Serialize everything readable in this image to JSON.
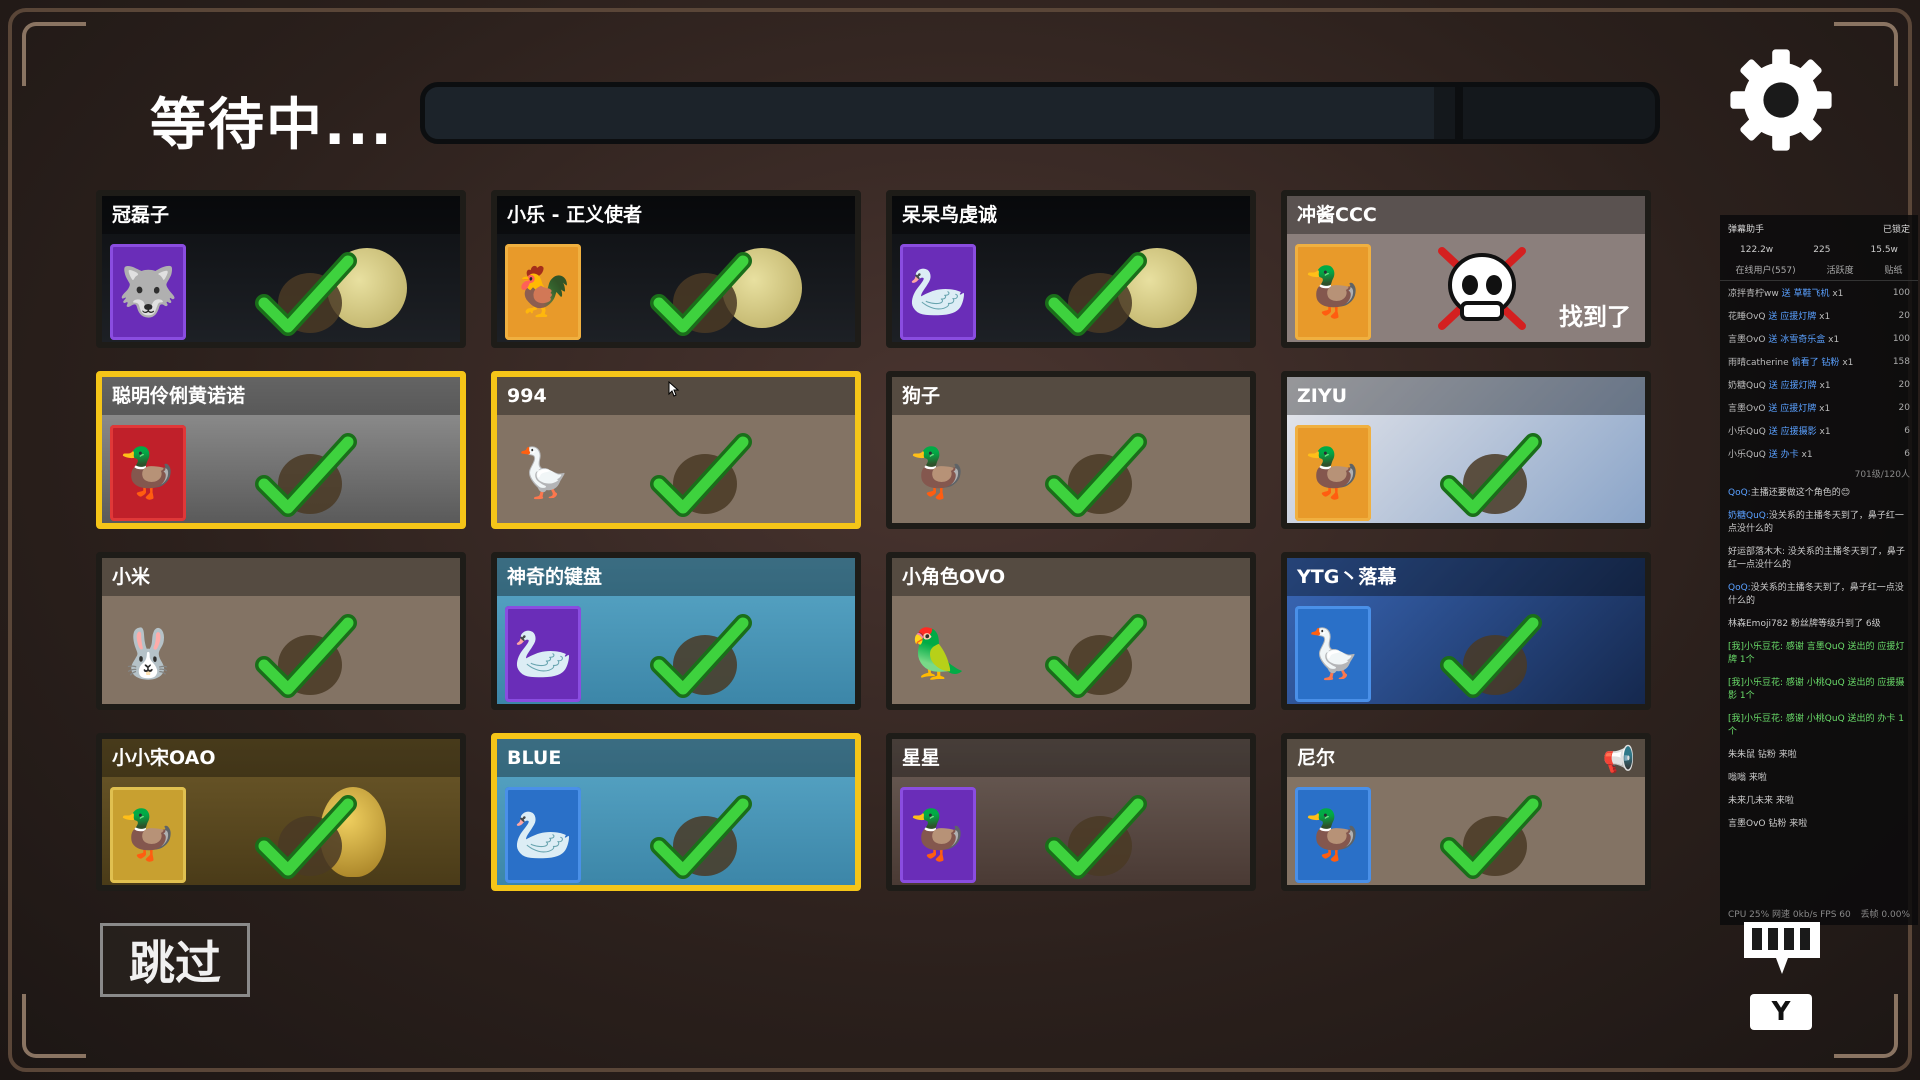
{
  "header": {
    "title": "等待中...",
    "progress": 0.82
  },
  "players": [
    {
      "name": "冠磊子",
      "bg": "bg-night",
      "portrait": "p-purple",
      "emoji": "🐺",
      "prop": "moon",
      "highlight": false
    },
    {
      "name": "小乐 - 正义使者",
      "bg": "bg-night",
      "portrait": "p-orange",
      "emoji": "🐓",
      "prop": "moon",
      "highlight": false
    },
    {
      "name": "呆呆鸟虔诚",
      "bg": "bg-night",
      "portrait": "p-purple",
      "emoji": "🦢",
      "prop": "moon",
      "highlight": false
    },
    {
      "name": "冲酱CCC",
      "bg": "bg-found",
      "portrait": "p-orange",
      "emoji": "🦆",
      "prop": "skull",
      "highlight": false,
      "status": "找到了"
    },
    {
      "name": "聪明伶俐黄诺诺",
      "bg": "bg-castle",
      "portrait": "p-red",
      "emoji": "🦆",
      "prop": "none",
      "highlight": true
    },
    {
      "name": "994",
      "bg": "bg-plain",
      "portrait": "p-none",
      "emoji": "🪿",
      "prop": "none",
      "highlight": true
    },
    {
      "name": "狗子",
      "bg": "bg-plain",
      "portrait": "p-none",
      "emoji": "🦆",
      "prop": "none",
      "highlight": false
    },
    {
      "name": "ZIYU",
      "bg": "bg-ziyu",
      "portrait": "p-orange",
      "emoji": "🦆",
      "prop": "none",
      "highlight": false
    },
    {
      "name": "小米",
      "bg": "bg-plain",
      "portrait": "p-none",
      "emoji": "🐰",
      "prop": "none",
      "highlight": false
    },
    {
      "name": "神奇的键盘",
      "bg": "bg-sky",
      "portrait": "p-purple",
      "emoji": "🦢",
      "prop": "none",
      "highlight": false
    },
    {
      "name": "小角色OVO",
      "bg": "bg-plain",
      "portrait": "p-none",
      "emoji": "🦜",
      "prop": "none",
      "highlight": false
    },
    {
      "name": "YTG丶落幕",
      "bg": "bg-ytg",
      "portrait": "p-blue",
      "emoji": "🪿",
      "prop": "none",
      "highlight": false
    },
    {
      "name": "小小宋OAO",
      "bg": "bg-gold",
      "portrait": "p-gold",
      "emoji": "🦆",
      "prop": "egg",
      "highlight": false
    },
    {
      "name": "BLUE",
      "bg": "bg-sky",
      "portrait": "p-blue",
      "emoji": "🦢",
      "prop": "none",
      "highlight": true
    },
    {
      "name": "星星",
      "bg": "bg-leaves",
      "portrait": "p-purple",
      "emoji": "🦆",
      "prop": "none",
      "highlight": false
    },
    {
      "name": "尼尔",
      "bg": "bg-plain",
      "portrait": "p-blue",
      "emoji": "🦆",
      "prop": "speaker",
      "highlight": false
    }
  ],
  "controls": {
    "skip_label": "跳过",
    "hotkey": "Y"
  },
  "sidebar": {
    "title": "弹幕助手",
    "lock_label": "已锁定",
    "stats": {
      "likes": "122.2w",
      "viewers": "225",
      "follows": "15.5w"
    },
    "tabs": [
      "在线用户(557)",
      "活跃度",
      "贴纸"
    ],
    "gifts": [
      {
        "user": "凉拌青柠ww",
        "action": "送 草鞋飞机",
        "count": "x1",
        "value": "100"
      },
      {
        "user": "花睡OvQ",
        "action": "送 应援灯牌",
        "count": "x1",
        "value": "20"
      },
      {
        "user": "言墨OvO",
        "action": "送 冰雪奇乐盒",
        "count": "x1",
        "value": "100"
      },
      {
        "user": "雨晴catherine",
        "action": "偷看了 钻粉",
        "count": "x1",
        "value": "158"
      },
      {
        "user": "奶糖QuQ",
        "action": "送 应援灯牌",
        "count": "x1",
        "value": "20"
      },
      {
        "user": "言墨OvO",
        "action": "送 应援灯牌",
        "count": "x1",
        "value": "20"
      },
      {
        "user": "小乐QuQ",
        "action": "送 应援摄影",
        "count": "x1",
        "value": "6"
      },
      {
        "user": "小乐QuQ",
        "action": "送 办卡",
        "count": "x1",
        "value": "6"
      }
    ],
    "divider": "701级/120人",
    "chat": [
      {
        "who": "QoQ:",
        "text": "主播还要做这个角色的😊",
        "sys": false
      },
      {
        "who": "奶糖QuQ:",
        "text": "没关系的主播冬天到了，鼻子红一点没什么的",
        "sys": false
      },
      {
        "who": "",
        "text": "好运部落木木: 没关系的主播冬天到了，鼻子红一点没什么的",
        "sys": false
      },
      {
        "who": "QoQ:",
        "text": "没关系的主播冬天到了，鼻子红一点没什么的",
        "sys": false
      },
      {
        "who": "",
        "text": "林森Emoji782 粉丝牌等级升到了 6级",
        "sys": false
      },
      {
        "who": "",
        "text": "[我]小乐豆花: 感谢 言墨QuQ 送出的 应援灯牌 1个",
        "sys": true
      },
      {
        "who": "",
        "text": "[我]小乐豆花: 感谢 小桃QuQ 送出的 应援摄影 1个",
        "sys": true
      },
      {
        "who": "",
        "text": "[我]小乐豆花: 感谢 小桃QuQ 送出的 办卡 1个",
        "sys": true
      },
      {
        "who": "",
        "text": "朱朱鼠 钻粉 来啦",
        "sys": false
      },
      {
        "who": "",
        "text": "嗡嗡 来啦",
        "sys": false
      },
      {
        "who": "",
        "text": "未来几未来 来啦",
        "sys": false
      },
      {
        "who": "",
        "text": "言墨OvO 钻粉 来啦",
        "sys": false
      }
    ],
    "footer_left": "CPU 25%  网速 0kb/s  FPS 60",
    "footer_right": "丢帧 0.00%"
  }
}
